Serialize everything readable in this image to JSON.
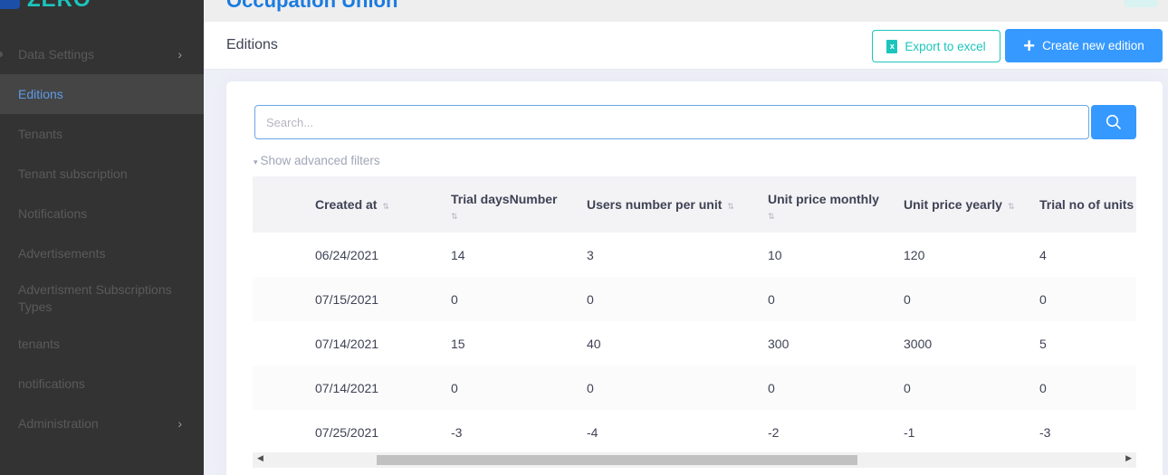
{
  "app": {
    "logo_text": "ZERO",
    "heading": "Occupation Union"
  },
  "sidebar": {
    "items": [
      {
        "label": "Data Settings",
        "has_chevron": true
      },
      {
        "label": "Editions",
        "active": true
      },
      {
        "label": "Tenants"
      },
      {
        "label": "Tenant subscription"
      },
      {
        "label": "Notifications"
      },
      {
        "label": "Advertisements"
      },
      {
        "label": "Advertisment Subscriptions Types"
      },
      {
        "label": "tenants"
      },
      {
        "label": "notifications"
      },
      {
        "label": "Administration",
        "has_chevron": true
      }
    ]
  },
  "subheader": {
    "title": "Editions",
    "export_label": "Export to excel",
    "create_label": "Create new edition"
  },
  "search": {
    "placeholder": "Search...",
    "advanced_label": "Show advanced filters"
  },
  "table": {
    "columns": [
      "Created at",
      "Trial daysNumber",
      "Users number per unit",
      "Unit price monthly",
      "Unit price yearly",
      "Trial no of units"
    ],
    "rows": [
      [
        "06/24/2021",
        "14",
        "3",
        "10",
        "120",
        "4"
      ],
      [
        "07/15/2021",
        "0",
        "0",
        "0",
        "0",
        "0"
      ],
      [
        "07/14/2021",
        "15",
        "40",
        "300",
        "3000",
        "5"
      ],
      [
        "07/14/2021",
        "0",
        "0",
        "0",
        "0",
        "0"
      ],
      [
        "07/25/2021",
        "-3",
        "-4",
        "-2",
        "-1",
        "-3"
      ]
    ]
  },
  "colors": {
    "accent": "#3699ff",
    "teal": "#1bc5bd",
    "sidebar_bg": "#333333",
    "heading": "#1a7be0"
  }
}
